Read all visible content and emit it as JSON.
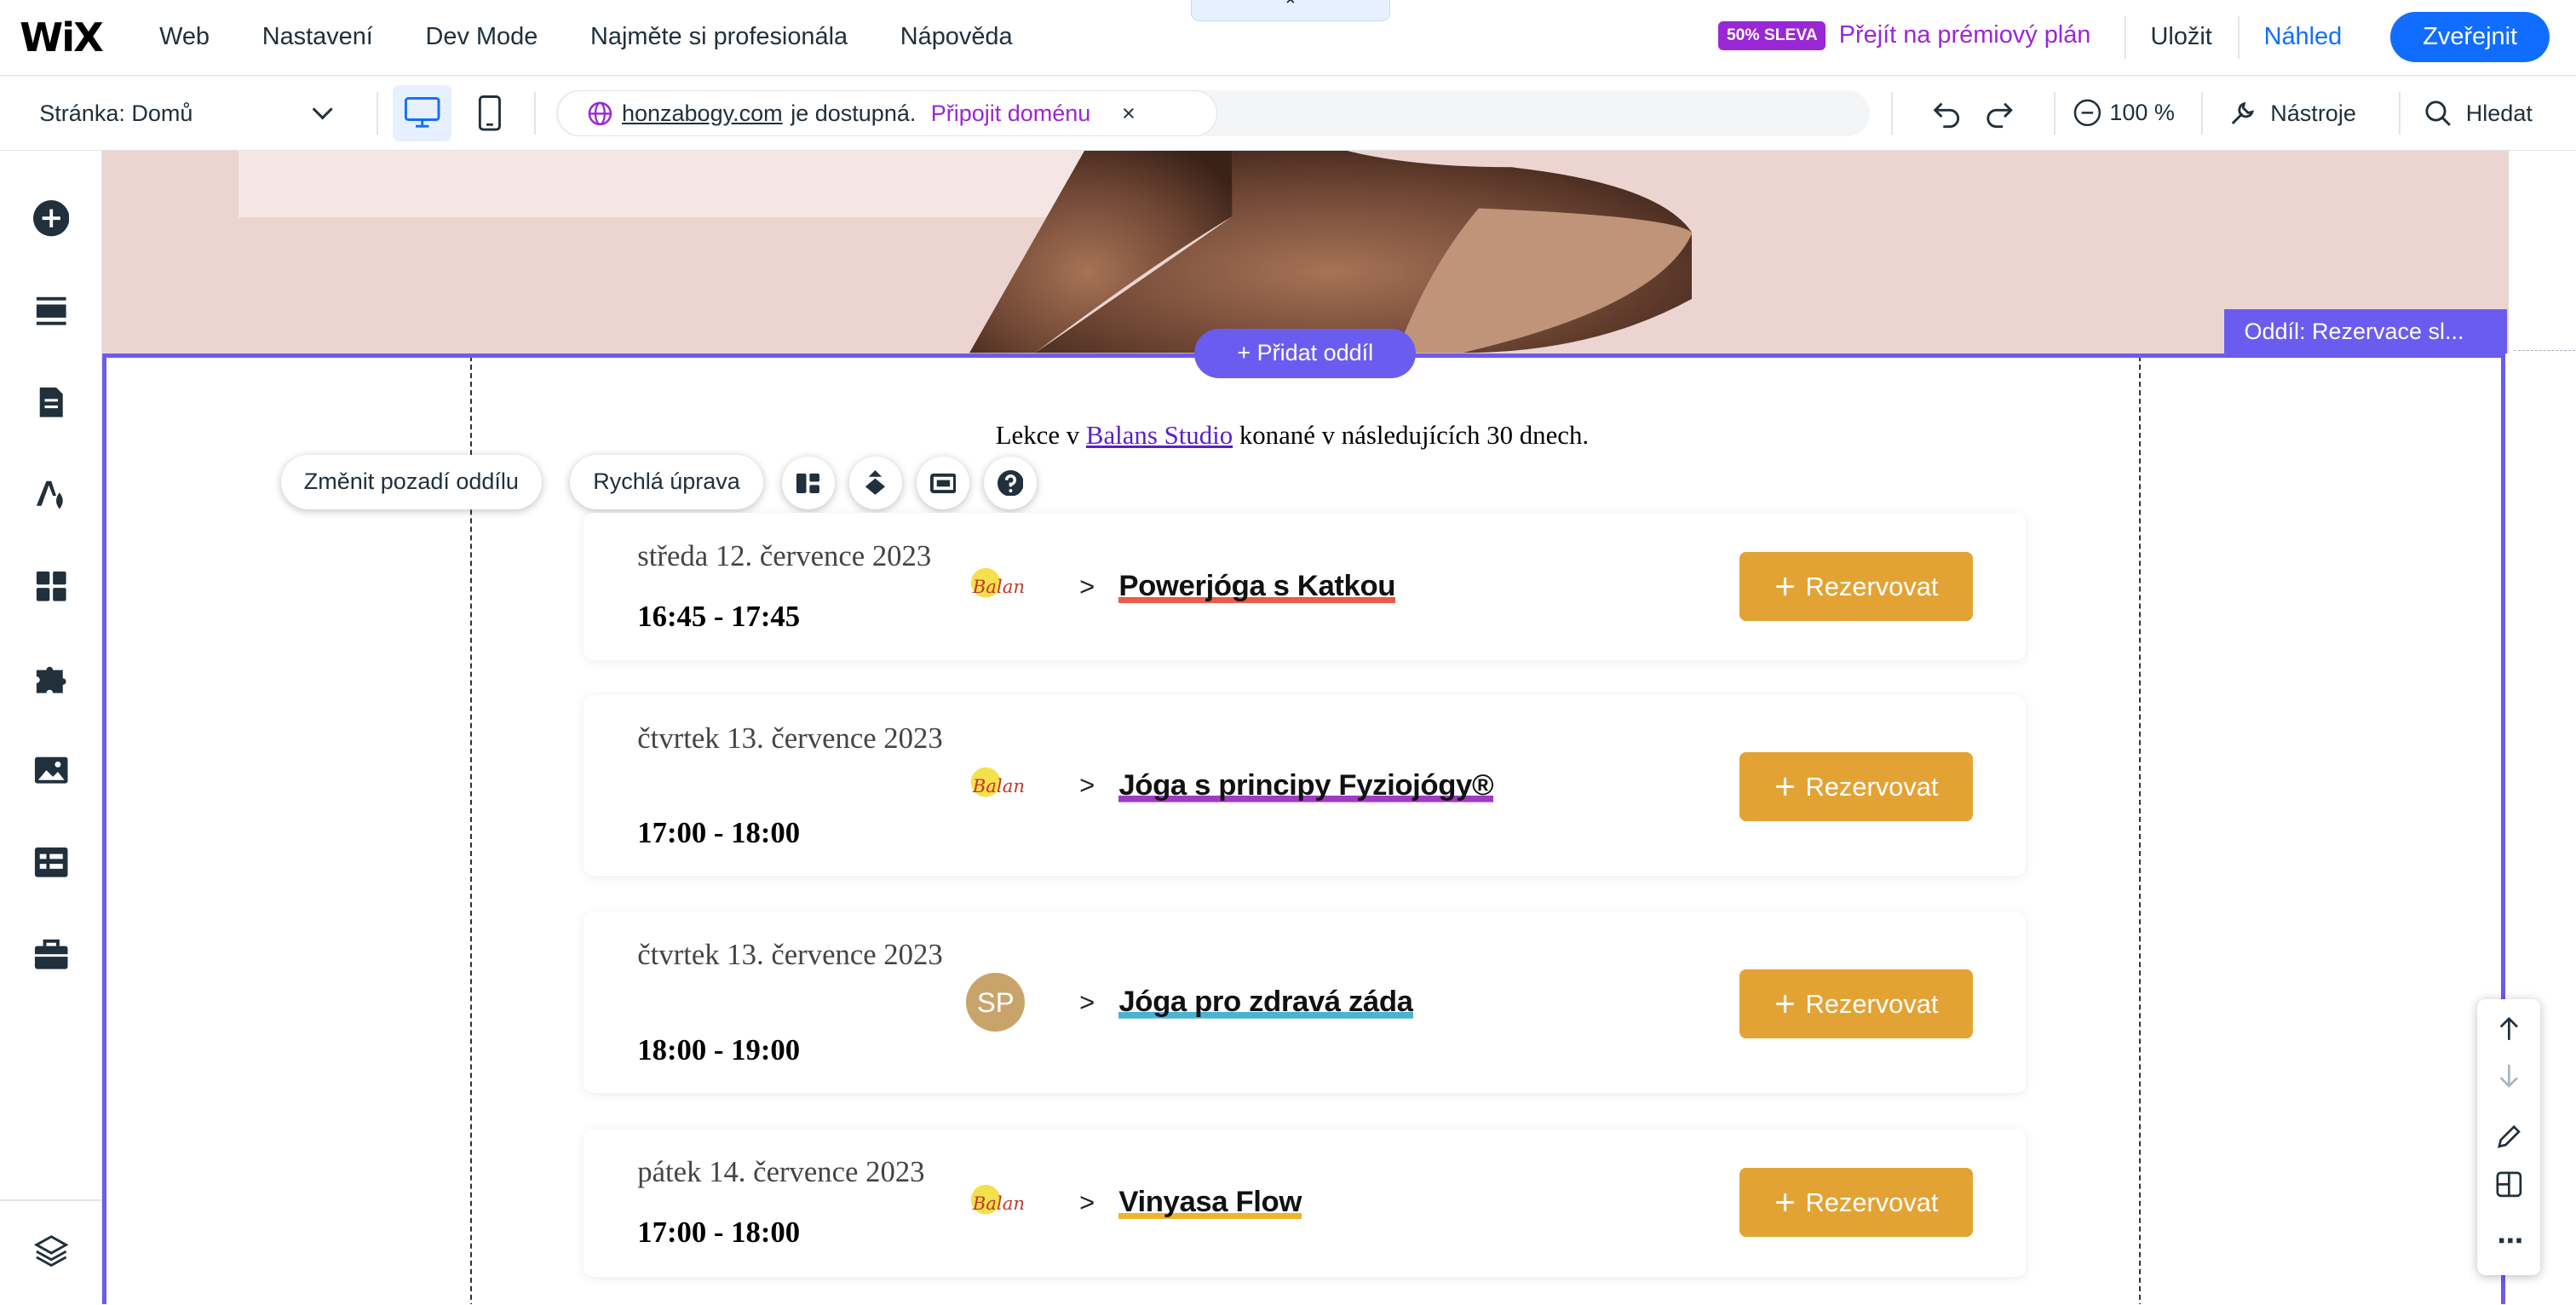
{
  "topbar": {
    "logo": "WiX",
    "menu": [
      "Web",
      "Nastavení",
      "Dev Mode",
      "Najměte si profesionála",
      "Nápověda"
    ],
    "collapse_glyph": "⌃",
    "badge": "50% SLEVA",
    "premium_link": "Přejít na prémiový plán",
    "save": "Uložit",
    "preview": "Náhled",
    "publish": "Zveřejnit"
  },
  "secondbar": {
    "page_select": "Stránka: Domů",
    "url_domain": "honzabogy.com",
    "url_text": "je dostupná.",
    "url_connect": "Připojit doménu",
    "url_close": "×",
    "zoom": "100 %",
    "tools": "Nástroje",
    "search": "Hledat"
  },
  "canvas": {
    "section_label": "Oddíl: Rezervace sl...",
    "add_section": "Přidat oddíl",
    "intro_before": "Lekce v ",
    "intro_link": "Balans Studio",
    "intro_after": " konané v následujících 30 dnech.",
    "change_bg": "Změnit pozadí oddílu",
    "quick_edit": "Rychlá úprava",
    "events": [
      {
        "date": "středa 12. července 2023",
        "time": "16:45 - 17:45",
        "image": "logo",
        "name": "Powerjóga s Katkou",
        "underline": "#e85c4a",
        "button": "Rezervovat"
      },
      {
        "date": "čtvrtek 13. července 2023",
        "time": "17:00 - 18:00",
        "image": "logo",
        "name": "Jóga s principy Fyziojógy®",
        "underline": "#a23bc4",
        "button": "Rezervovat"
      },
      {
        "date": "čtvrtek 13. července 2023",
        "time": "18:00 - 19:00",
        "image": "avatar",
        "initials": "SP",
        "name": "Jóga pro zdravá záda",
        "underline": "#4bb3d2",
        "button": "Rezervovat"
      },
      {
        "date": "pátek 14. července 2023",
        "time": "17:00 - 18:00",
        "image": "logo",
        "name": "Vinyasa Flow",
        "underline": "#f0b429",
        "button": "Rezervovat"
      }
    ]
  },
  "float_panel": {
    "more": "⋯"
  },
  "colors": {
    "accent": "#116dff",
    "premium": "#9a27d5",
    "selection": "#6b5cf0",
    "book_button": "#e3a334"
  }
}
